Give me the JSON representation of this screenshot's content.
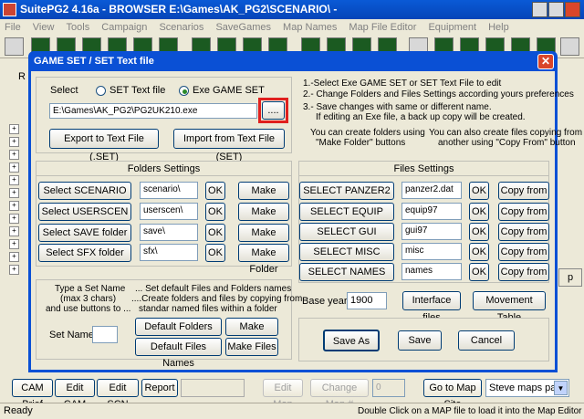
{
  "app": {
    "title": "SuitePG2 4.16a  - BROWSER  E:\\Games\\AK_PG2\\SCENARIO\\ -",
    "menu": [
      "File",
      "View",
      "Tools",
      "Campaign",
      "Scenarios",
      "SaveGames",
      "Map Names",
      "Map File Editor",
      "Equipment",
      "Help"
    ],
    "bottom_buttons": {
      "cam_brief": "CAM Brief",
      "edit_cam": "Edit CAM",
      "edit_scn": "Edit SCN",
      "report": "Report",
      "edit_map": "Edit Map",
      "change_map": "Change Map #",
      "change_map_value": "0",
      "goto_site": "Go to Map Site",
      "maps_page": "Steve maps page"
    },
    "status_left": "Ready",
    "status_right": "Double Click on a MAP file to load it into the Map Editor",
    "partial_left_label": "R",
    "partial_right_label": "p"
  },
  "dialog": {
    "title": "GAME SET  /  SET Text file",
    "select_label": "Select",
    "radio_text": "SET Text file",
    "radio_exe": "Exe GAME SET",
    "radio_selected": "exe",
    "exe_path": "E:\\Games\\AK_PG2\\PG2UK210.exe",
    "browse_label": "....",
    "export_label": "Export to Text File (.SET)",
    "import_label": "Import from Text File (SET)",
    "info_lines": [
      "1.-Select Exe GAME SET or SET Text File to edit",
      "2.- Change Folders and Files Settings according yours  preferences",
      "3.- Save changes with same or different name.",
      "If editing an Exe file, a back up copy will be created."
    ],
    "info_folders": [
      "You can create folders using",
      "\"Make Folder\" buttons"
    ],
    "info_files": [
      "You can also create files copying from",
      "another using \"Copy From\" button"
    ],
    "folders": {
      "heading": "Folders Settings",
      "rows": [
        {
          "button": "Select SCENARIO folder",
          "value": "scenario\\",
          "ok": "OK",
          "make": "Make Folder"
        },
        {
          "button": "Select USERSCEN folder",
          "value": "userscen\\",
          "ok": "OK",
          "make": "Make Folder"
        },
        {
          "button": "Select SAVE folder",
          "value": "save\\",
          "ok": "OK",
          "make": "Make Folder"
        },
        {
          "button": "Select SFX folder",
          "value": "sfx\\",
          "ok": "OK",
          "make": "Make Folder"
        }
      ]
    },
    "files": {
      "heading": "Files Settings",
      "rows": [
        {
          "button": "SELECT PANZER2",
          "value": "panzer2.dat",
          "ok": "OK",
          "copy": "Copy from"
        },
        {
          "button": "SELECT EQUIP",
          "value": "equip97",
          "ok": "OK",
          "copy": "Copy from"
        },
        {
          "button": "SELECT GUI",
          "value": "gui97",
          "ok": "OK",
          "copy": "Copy from"
        },
        {
          "button": "SELECT MISC",
          "value": "misc",
          "ok": "OK",
          "copy": "Copy from"
        },
        {
          "button": "SELECT NAMES",
          "value": "names",
          "ok": "OK",
          "copy": "Copy from"
        }
      ]
    },
    "setname": {
      "left_lines": [
        "Type a Set Name",
        "(max 3 chars)",
        "and use buttons to ..."
      ],
      "right_lines": [
        "... Set default Files and Folders names",
        "....Create folders and files by copying from",
        "standar named files within a folder"
      ],
      "label": "Set Name:",
      "value": "",
      "default_folders": "Default Folders Names",
      "make_folders": "Make Folders",
      "default_files": "Default Files Names",
      "make_files": "Make Files"
    },
    "base_year_label": "Base year",
    "base_year_value": "1900",
    "interface_files": "Interface files",
    "movement_table": "Movement Table",
    "save_as": "Save As",
    "save": "Save",
    "cancel": "Cancel"
  }
}
